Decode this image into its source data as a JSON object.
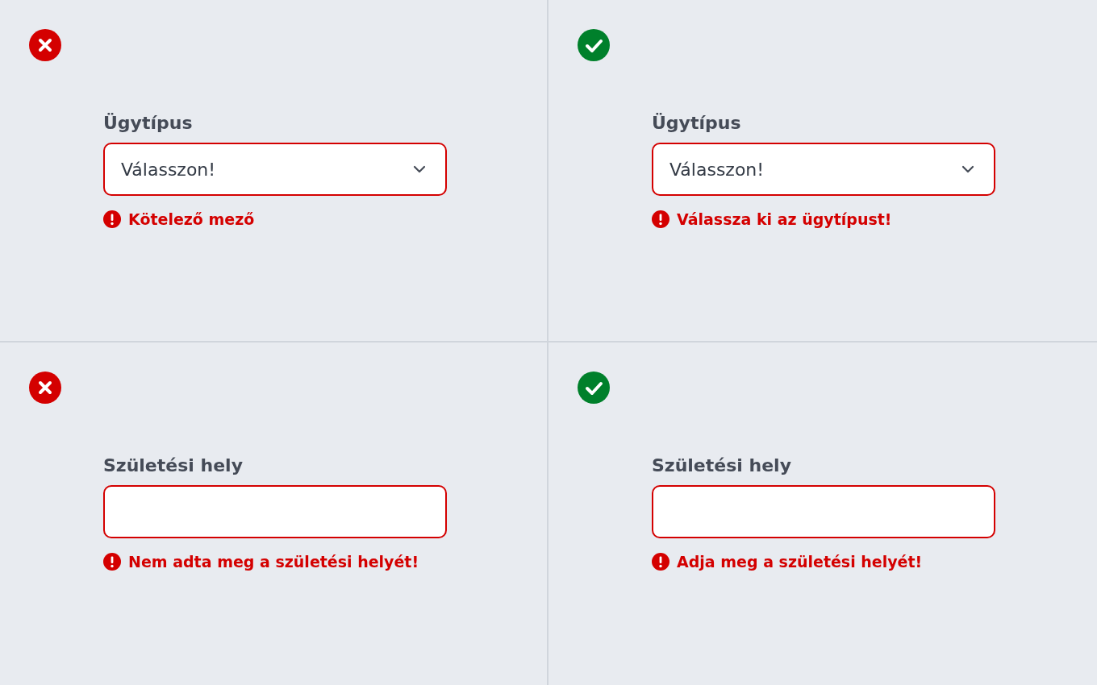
{
  "panels": [
    {
      "kind": "bad",
      "field": {
        "kind": "select",
        "label": "Ügytípus",
        "value": "Válasszon!",
        "invalid": true
      },
      "error": "Kötelező mező"
    },
    {
      "kind": "good",
      "field": {
        "kind": "select",
        "label": "Ügytípus",
        "value": "Válasszon!",
        "invalid": true
      },
      "error": "Válassza ki az ügytípust!"
    },
    {
      "kind": "bad",
      "field": {
        "kind": "text",
        "label": "Születési hely",
        "invalid": true
      },
      "error": "Nem adta meg a születési helyét!"
    },
    {
      "kind": "good",
      "field": {
        "kind": "text",
        "label": "Születési hely",
        "invalid": true
      },
      "error": "Adja meg a születési helyét!"
    }
  ]
}
